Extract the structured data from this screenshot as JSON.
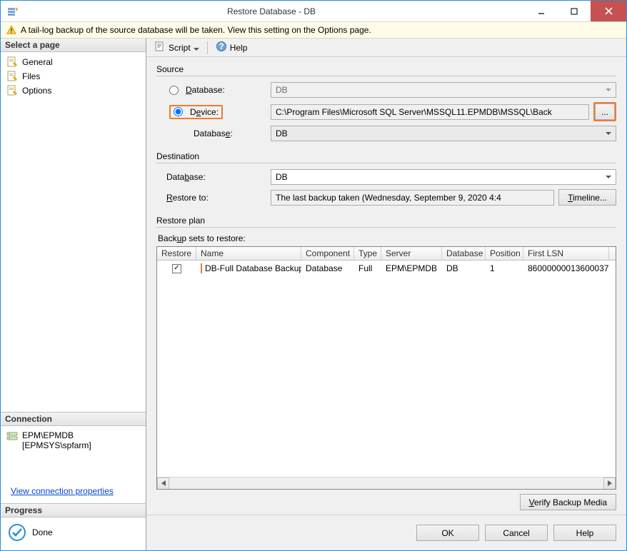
{
  "window": {
    "title": "Restore Database - DB"
  },
  "notice": {
    "text": "A tail-log backup of the source database will be taken. View this setting on the Options page."
  },
  "sidebar": {
    "select_page_header": "Select a page",
    "pages": [
      {
        "label": "General"
      },
      {
        "label": "Files"
      },
      {
        "label": "Options"
      }
    ],
    "connection_header": "Connection",
    "connection_server": "EPM\\EPMDB",
    "connection_user": "[EPMSYS\\spfarm]",
    "view_connection_link": "View connection properties",
    "progress_header": "Progress",
    "progress_status": "Done"
  },
  "toolbar": {
    "script_label": "Script",
    "help_label": "Help"
  },
  "source": {
    "group_label": "Source",
    "database_radio_label": "Database:",
    "device_radio_label": "Device:",
    "database_dropdown_value": "DB",
    "device_path": "C:\\Program Files\\Microsoft SQL Server\\MSSQL11.EPMDB\\MSSQL\\Back",
    "browse_label": "...",
    "inner_database_label": "Database:",
    "inner_database_value": "DB"
  },
  "destination": {
    "group_label": "Destination",
    "database_label": "Database:",
    "database_value": "DB",
    "restore_to_label": "Restore to:",
    "restore_to_value": "The last backup taken (Wednesday, September 9, 2020 4:4",
    "timeline_label": "Timeline..."
  },
  "plan": {
    "group_label": "Restore plan",
    "subtitle": "Backup sets to restore:",
    "columns": {
      "restore": "Restore",
      "name": "Name",
      "component": "Component",
      "type": "Type",
      "server": "Server",
      "database": "Database",
      "position": "Position",
      "first_lsn": "First LSN"
    },
    "rows": [
      {
        "restore": true,
        "name": "DB-Full Database Backup",
        "component": "Database",
        "type": "Full",
        "server": "EPM\\EPMDB",
        "database": "DB",
        "position": "1",
        "first_lsn": "86000000013600037"
      }
    ],
    "verify_label": "Verify Backup Media"
  },
  "buttons": {
    "ok": "OK",
    "cancel": "Cancel",
    "help": "Help"
  }
}
